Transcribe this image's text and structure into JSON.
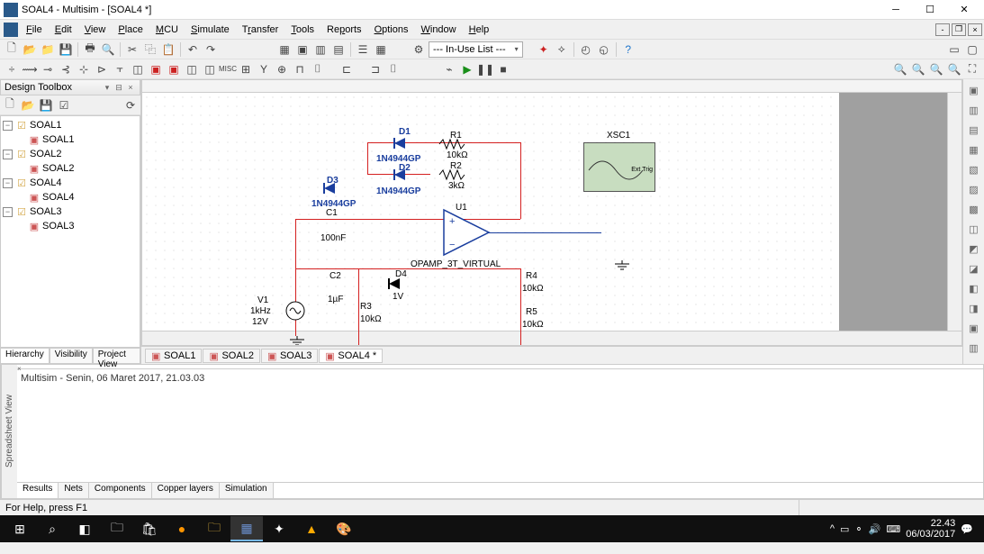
{
  "title": "SOAL4 - Multisim - [SOAL4 *]",
  "menus": [
    "File",
    "Edit",
    "View",
    "Place",
    "MCU",
    "Simulate",
    "Transfer",
    "Tools",
    "Reports",
    "Options",
    "Window",
    "Help"
  ],
  "inUseList": "--- In-Use List ---",
  "designToolbox": {
    "title": "Design Toolbox",
    "tree": [
      {
        "label": "SOAL1",
        "child": "SOAL1"
      },
      {
        "label": "SOAL2",
        "child": "SOAL2"
      },
      {
        "label": "SOAL4",
        "child": "SOAL4"
      },
      {
        "label": "SOAL3",
        "child": "SOAL3"
      }
    ],
    "tabs": [
      "Hierarchy",
      "Visibility",
      "Project View"
    ]
  },
  "schematicTabs": [
    "SOAL1",
    "SOAL2",
    "SOAL3",
    "SOAL4 *"
  ],
  "activeSchTab": 3,
  "components": {
    "D1": {
      "name": "D1",
      "val": "1N4944GP"
    },
    "D2": {
      "name": "D2",
      "val": "1N4944GP"
    },
    "D3": {
      "name": "D3",
      "val": "1N4944GP"
    },
    "D4": {
      "name": "D4",
      "val": "1V"
    },
    "R1": {
      "name": "R1",
      "val": "10kΩ"
    },
    "R2": {
      "name": "R2",
      "val": "3kΩ"
    },
    "R3": {
      "name": "R3",
      "val": "10kΩ"
    },
    "R4": {
      "name": "R4",
      "val": "10kΩ"
    },
    "R5": {
      "name": "R5",
      "val": "10kΩ"
    },
    "C1": {
      "name": "C1",
      "val": "100nF"
    },
    "C2": {
      "name": "C2",
      "val": "1µF"
    },
    "V1": {
      "name": "V1",
      "val1": "1kHz",
      "val2": "12V"
    },
    "U1": {
      "name": "U1",
      "val": "OPAMP_3T_VIRTUAL"
    },
    "XSC1": {
      "name": "XSC1"
    }
  },
  "spreadsheet": {
    "label": "Spreadsheet View",
    "msg": "Multisim  - Senin, 06 Maret 2017, 21.03.03",
    "tabs": [
      "Results",
      "Nets",
      "Components",
      "Copper layers",
      "Simulation"
    ]
  },
  "status": "For Help, press F1",
  "clock": {
    "time": "22.43",
    "date": "06/03/2017"
  }
}
